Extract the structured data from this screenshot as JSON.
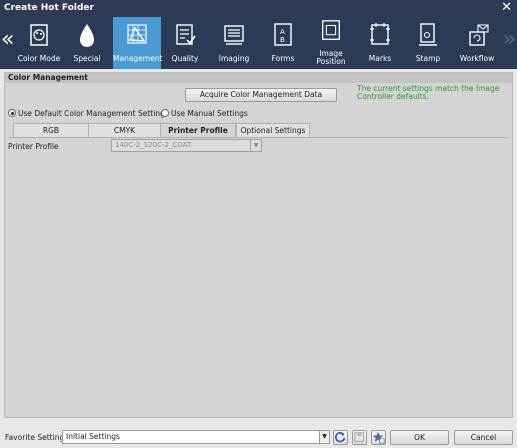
{
  "window": {
    "title": "Create Hot Folder",
    "close_icon": "close-icon"
  },
  "toolbar": {
    "tabs": [
      {
        "label": "Color Mode",
        "icon": "color-mode-icon"
      },
      {
        "label": "Special",
        "icon": "special-icon"
      },
      {
        "label": "Management",
        "icon": "management-icon",
        "active": true
      },
      {
        "label": "Quality",
        "icon": "quality-icon"
      },
      {
        "label": "Imaging",
        "icon": "imaging-icon"
      },
      {
        "label": "Forms",
        "icon": "forms-icon"
      },
      {
        "label": "Image Position",
        "icon": "image-position-icon"
      },
      {
        "label": "Marks",
        "icon": "marks-icon"
      },
      {
        "label": "Stamp",
        "icon": "stamp-icon"
      },
      {
        "label": "Workflow",
        "icon": "workflow-icon"
      }
    ],
    "prev_arrow": "«",
    "next_arrow": "»"
  },
  "panel": {
    "header": "Color Management",
    "acquire_button": "Acquire Color Management Data",
    "status_message": "The current settings match the Image Controller defaults.",
    "radio_default": "Use Default Color Management Settings",
    "radio_manual": "Use Manual Settings",
    "subtabs": [
      "RGB",
      "CMYK",
      "Printer Profile",
      "Optional Settings"
    ],
    "printer_profile_label": "Printer Profile",
    "printer_profile_value": "140C-2_120C-2_COAT"
  },
  "footer": {
    "favorite_label": "Favorite Setting",
    "favorite_value": "Initial Settings",
    "ok_label": "OK",
    "cancel_label": "Cancel"
  },
  "colors": {
    "titlebar": "#2f3b55",
    "toolbar": "#2b3a55",
    "active_tab": "#4a9ad4",
    "status_text": "#2a9a2a"
  }
}
